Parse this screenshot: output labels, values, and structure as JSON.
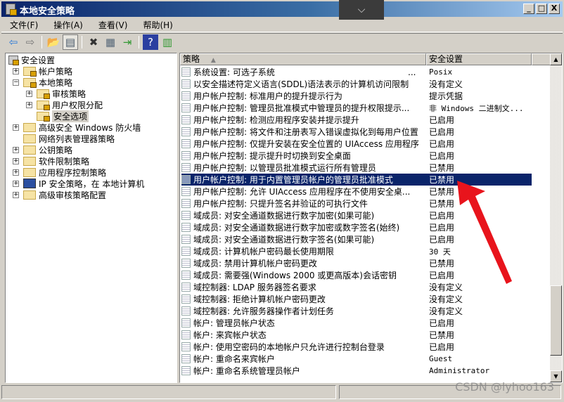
{
  "window": {
    "title": "本地安全策略",
    "dropdown_icon": "⌵",
    "minimize": "_",
    "maximize": "□",
    "close": "X"
  },
  "menu": [
    "文件(F)",
    "操作(A)",
    "查看(V)",
    "帮助(H)"
  ],
  "toolbar": [
    "back-icon",
    "forward-icon",
    "up-folder-icon",
    "show-hide-tree-icon",
    "delete-icon",
    "properties-icon",
    "export-list-icon",
    "help-icon",
    "show-action-pane-icon"
  ],
  "toolbar_glyphs": [
    "⇦",
    "⇨",
    "📂",
    "▤",
    "✖",
    "▦",
    "⇥",
    "?",
    "▥"
  ],
  "tree": {
    "root": "安全设置",
    "items": [
      {
        "label": "帐户策略",
        "level": 1,
        "expander": "+",
        "icon": "lock"
      },
      {
        "label": "本地策略",
        "level": 1,
        "expander": "−",
        "icon": "lock"
      },
      {
        "label": "审核策略",
        "level": 2,
        "expander": "+",
        "icon": "lock"
      },
      {
        "label": "用户权限分配",
        "level": 2,
        "expander": "+",
        "icon": "lock"
      },
      {
        "label": "安全选项",
        "level": 2,
        "expander": "",
        "icon": "lock",
        "selected": true
      },
      {
        "label": "高级安全 Windows 防火墙",
        "level": 1,
        "expander": "+",
        "icon": "folder"
      },
      {
        "label": "网络列表管理器策略",
        "level": 1,
        "expander": "",
        "icon": "folder"
      },
      {
        "label": "公钥策略",
        "level": 1,
        "expander": "+",
        "icon": "folder"
      },
      {
        "label": "软件限制策略",
        "level": 1,
        "expander": "+",
        "icon": "folder"
      },
      {
        "label": "应用程序控制策略",
        "level": 1,
        "expander": "+",
        "icon": "folder"
      },
      {
        "label": "IP 安全策略，在 本地计算机",
        "level": 1,
        "expander": "+",
        "icon": "ip"
      },
      {
        "label": "高级审核策略配置",
        "level": 1,
        "expander": "+",
        "icon": "folder"
      }
    ]
  },
  "list": {
    "columns": [
      "策略",
      "安全设置"
    ],
    "sort_indicator": "▲",
    "rows": [
      {
        "policy": "系统设置: 可选子系统",
        "suffix": "...",
        "setting": "Posix"
      },
      {
        "policy": "以安全描述符定义语言(SDDL)语法表示的计算机访问限制",
        "setting": "没有定义"
      },
      {
        "policy": "用户帐户控制: 标准用户的提升提示行为",
        "setting": "提示凭据"
      },
      {
        "policy": "用户帐户控制: 管理员批准模式中管理员的提升权限提示...",
        "setting": "非 Windows 二进制文..."
      },
      {
        "policy": "用户帐户控制: 检测应用程序安装并提示提升",
        "setting": "已启用"
      },
      {
        "policy": "用户帐户控制: 将文件和注册表写入错误虚拟化到每用户位置",
        "setting": "已启用"
      },
      {
        "policy": "用户帐户控制: 仅提升安装在安全位置的 UIAccess 应用程序",
        "setting": "已启用"
      },
      {
        "policy": "用户帐户控制: 提示提升时切换到安全桌面",
        "setting": "已启用"
      },
      {
        "policy": "用户帐户控制: 以管理员批准模式运行所有管理员",
        "setting": "已禁用"
      },
      {
        "policy": "用户帐户控制: 用于内置管理员帐户的管理员批准模式",
        "setting": "已禁用",
        "selected": true
      },
      {
        "policy": "用户帐户控制: 允许 UIAccess 应用程序在不使用安全桌...",
        "setting": "已禁用"
      },
      {
        "policy": "用户帐户控制: 只提升签名并验证的可执行文件",
        "setting": "已禁用"
      },
      {
        "policy": "域成员: 对安全通道数据进行数字加密(如果可能)",
        "setting": "已启用"
      },
      {
        "policy": "域成员: 对安全通道数据进行数字加密或数字签名(始终)",
        "setting": "已启用"
      },
      {
        "policy": "域成员: 对安全通道数据进行数字签名(如果可能)",
        "setting": "已启用"
      },
      {
        "policy": "域成员: 计算机帐户密码最长使用期限",
        "setting": "30 天"
      },
      {
        "policy": "域成员: 禁用计算机帐户密码更改",
        "setting": "已禁用"
      },
      {
        "policy": "域成员: 需要强(Windows 2000 或更高版本)会话密钥",
        "setting": "已启用"
      },
      {
        "policy": "域控制器: LDAP 服务器签名要求",
        "setting": "没有定义"
      },
      {
        "policy": "域控制器: 拒绝计算机帐户密码更改",
        "setting": "没有定义"
      },
      {
        "policy": "域控制器: 允许服务器操作者计划任务",
        "setting": "没有定义"
      },
      {
        "policy": "帐户: 管理员帐户状态",
        "setting": "已启用"
      },
      {
        "policy": "帐户: 来宾帐户状态",
        "setting": "已禁用"
      },
      {
        "policy": "帐户: 使用空密码的本地帐户只允许进行控制台登录",
        "setting": "已启用"
      },
      {
        "policy": "帐户: 重命名来宾帐户",
        "setting": "Guest"
      },
      {
        "policy": "帐户: 重命名系统管理员帐户",
        "setting": "Administrator"
      }
    ]
  },
  "watermark": "CSDN @lyhoo163",
  "colors": {
    "selection": "#0a246a",
    "annotation_arrow": "#e8141c"
  }
}
